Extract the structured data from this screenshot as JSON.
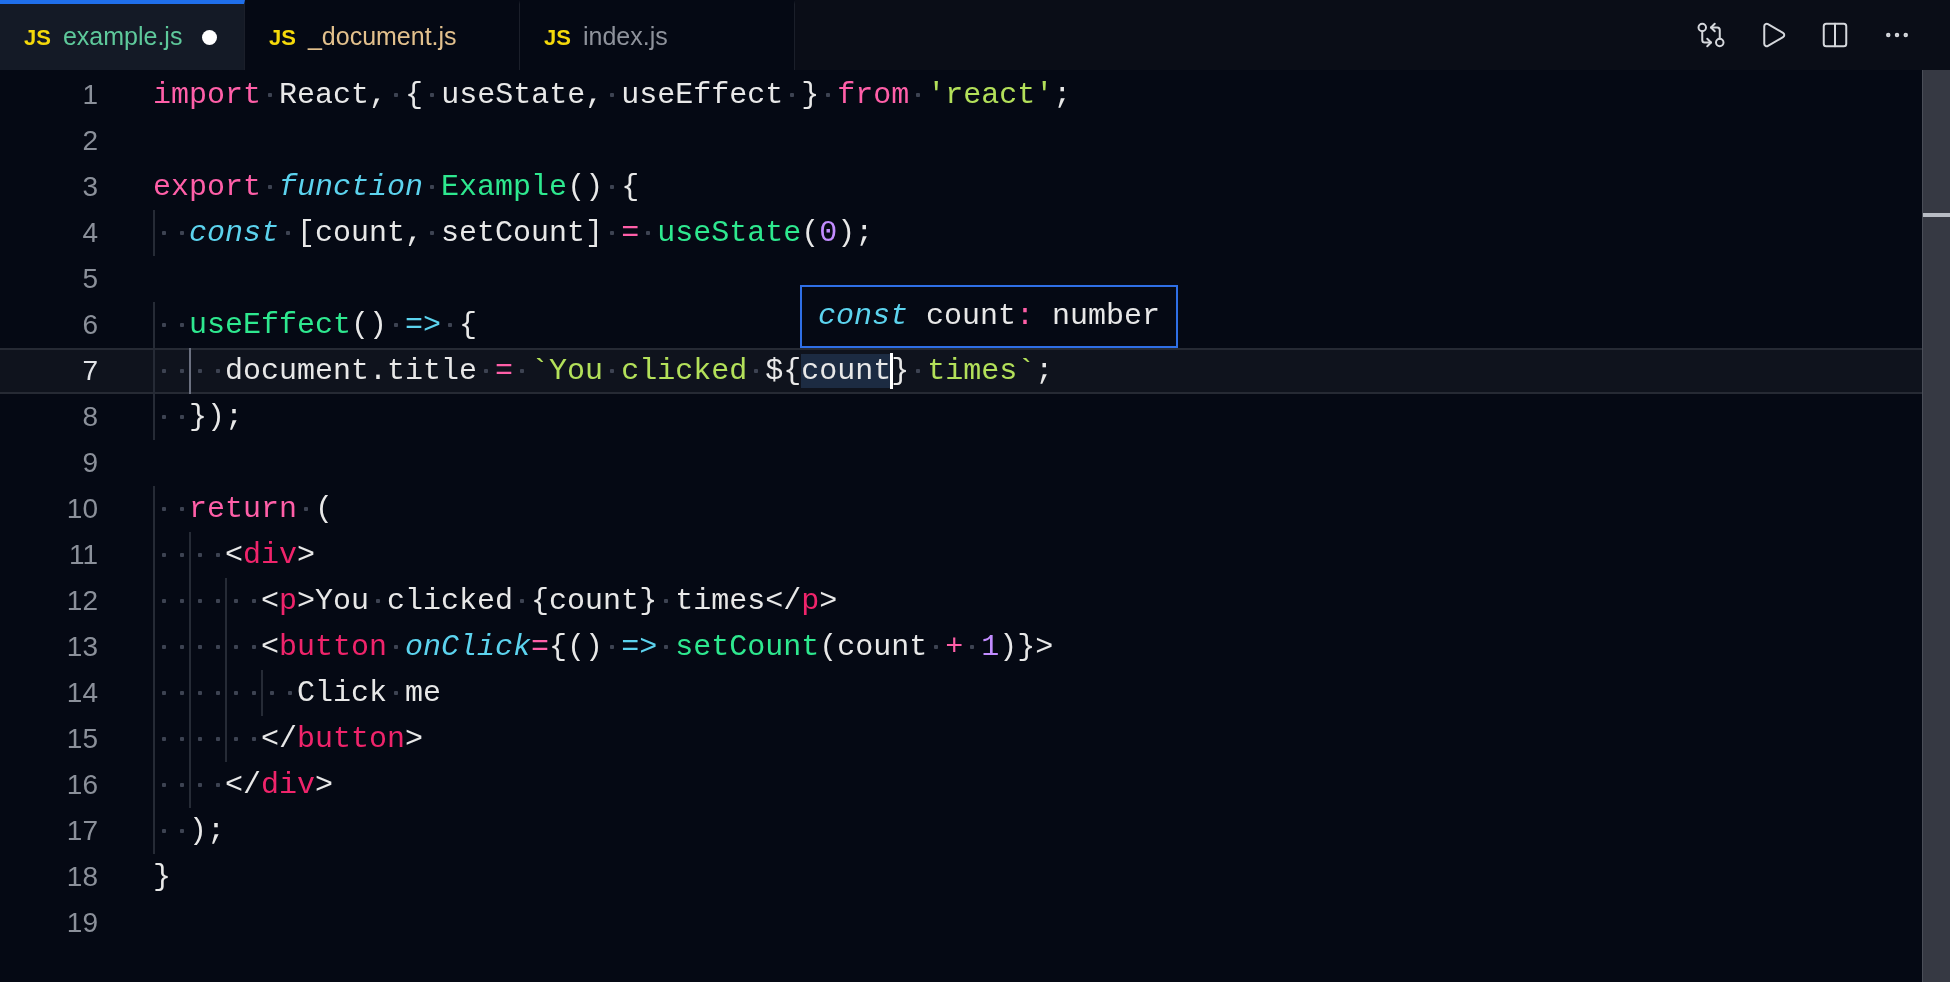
{
  "tabs": [
    {
      "icon": "JS",
      "label": "example.js",
      "selected": true,
      "modified": true,
      "color": "#5ec99b"
    },
    {
      "icon": "JS",
      "label": "_document.js",
      "selected": false,
      "modified": false,
      "color": "#e2c08d"
    },
    {
      "icon": "JS",
      "label": "index.js",
      "selected": false,
      "modified": false,
      "color": "#8e929b"
    }
  ],
  "lines": [
    {
      "number": "1",
      "current": false,
      "tokens": [
        {
          "kind": "keyword",
          "text": "import"
        },
        {
          "kind": "plain",
          "text": " React, { useState, useEffect } "
        },
        {
          "kind": "keyword",
          "text": "from"
        },
        {
          "kind": "string",
          "text": " 'react'"
        },
        {
          "kind": "plain",
          "text": ";"
        }
      ]
    },
    {
      "number": "2",
      "current": false
    },
    {
      "number": "3",
      "current": false,
      "tokens": [
        {
          "kind": "keyword",
          "text": "export"
        },
        {
          "kind": "storage",
          "text": " function"
        },
        {
          "kind": "function",
          "text": " Example"
        },
        {
          "kind": "plain",
          "text": "() {"
        }
      ]
    },
    {
      "number": "4",
      "current": false,
      "tokens": [
        {
          "kind": "storage",
          "text": "  const"
        },
        {
          "kind": "plain",
          "text": " [count, setCount] "
        },
        {
          "kind": "operator",
          "text": "="
        },
        {
          "kind": "function",
          "text": " useState"
        },
        {
          "kind": "plain",
          "text": "("
        },
        {
          "kind": "number",
          "text": "0"
        },
        {
          "kind": "plain",
          "text": ");"
        }
      ]
    },
    {
      "number": "5",
      "current": false
    },
    {
      "number": "6",
      "current": false,
      "tokens": [
        {
          "kind": "function",
          "text": "  useEffect"
        },
        {
          "kind": "plain",
          "text": "() "
        },
        {
          "kind": "arrow",
          "text": "=>"
        },
        {
          "kind": "plain",
          "text": " {"
        }
      ]
    },
    {
      "number": "7",
      "current": true,
      "tokens": [
        {
          "kind": "plain",
          "text": "    document.title "
        },
        {
          "kind": "operator",
          "text": "="
        },
        {
          "kind": "string",
          "text": " `You clicked "
        },
        {
          "kind": "plain",
          "text": "${"
        },
        {
          "kind": "highlight",
          "text": "count"
        },
        {
          "kind": "plain",
          "text": "}"
        },
        {
          "kind": "string",
          "text": " times`"
        },
        {
          "kind": "plain",
          "text": ";"
        }
      ]
    },
    {
      "number": "8",
      "current": false,
      "tokens": [
        {
          "kind": "plain",
          "text": "  });"
        }
      ]
    },
    {
      "number": "9",
      "current": false
    },
    {
      "number": "10",
      "current": false,
      "tokens": [
        {
          "kind": "keyword",
          "text": "  return"
        },
        {
          "kind": "plain",
          "text": " ("
        }
      ]
    },
    {
      "number": "11",
      "current": false,
      "tokens": [
        {
          "kind": "plain",
          "text": "    <"
        },
        {
          "kind": "tag",
          "text": "div"
        },
        {
          "kind": "plain",
          "text": ">"
        }
      ]
    },
    {
      "number": "12",
      "current": false,
      "tokens": [
        {
          "kind": "plain",
          "text": "      <"
        },
        {
          "kind": "tag",
          "text": "p"
        },
        {
          "kind": "plain",
          "text": ">You clicked {count} times</"
        },
        {
          "kind": "tag",
          "text": "p"
        },
        {
          "kind": "plain",
          "text": ">"
        }
      ]
    },
    {
      "number": "13",
      "current": false,
      "tokens": [
        {
          "kind": "plain",
          "text": "      <"
        },
        {
          "kind": "tag",
          "text": "button"
        },
        {
          "kind": "attribute",
          "text": " onClick"
        },
        {
          "kind": "operator",
          "text": "="
        },
        {
          "kind": "plain",
          "text": "{() "
        },
        {
          "kind": "arrow",
          "text": "=>"
        },
        {
          "kind": "function",
          "text": " setCount"
        },
        {
          "kind": "plain",
          "text": "(count "
        },
        {
          "kind": "operator",
          "text": "+"
        },
        {
          "kind": "number",
          "text": " 1"
        },
        {
          "kind": "plain",
          "text": ")}>"
        }
      ]
    },
    {
      "number": "14",
      "current": false,
      "tokens": [
        {
          "kind": "plain",
          "text": "        Click me"
        }
      ]
    },
    {
      "number": "15",
      "current": false,
      "tokens": [
        {
          "kind": "plain",
          "text": "      </"
        },
        {
          "kind": "tag",
          "text": "button"
        },
        {
          "kind": "plain",
          "text": ">"
        }
      ]
    },
    {
      "number": "16",
      "current": false,
      "tokens": [
        {
          "kind": "plain",
          "text": "    </"
        },
        {
          "kind": "tag",
          "text": "div"
        },
        {
          "kind": "plain",
          "text": ">"
        }
      ]
    },
    {
      "number": "17",
      "current": false,
      "tokens": [
        {
          "kind": "plain",
          "text": "  );"
        }
      ]
    },
    {
      "number": "18",
      "current": false,
      "tokens": [
        {
          "kind": "plain",
          "text": "}"
        }
      ]
    },
    {
      "number": "19",
      "current": false
    }
  ],
  "hover": {
    "tokens": [
      {
        "kind": "storage",
        "text": "const"
      },
      {
        "kind": "plain",
        "text": " count"
      },
      {
        "kind": "operator",
        "text": ":"
      },
      {
        "kind": "plain",
        "text": " number"
      }
    ]
  }
}
